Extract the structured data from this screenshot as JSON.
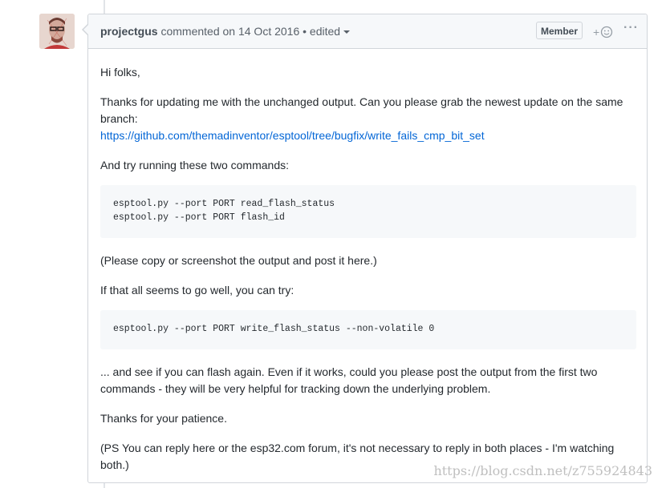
{
  "comment": {
    "author": "projectgus",
    "action_text": " commented on 14 Oct 2016 • edited",
    "badge": "Member",
    "reaction_plus": "+",
    "more_icon": "···",
    "body": {
      "p1": "Hi folks,",
      "p2": "Thanks for updating me with the unchanged output. Can you please grab the newest update on the same branch:",
      "link": "https://github.com/themadinventor/esptool/tree/bugfix/write_fails_cmp_bit_set",
      "p3": "And try running these two commands:",
      "code1": [
        "esptool.py --port PORT read_flash_status",
        "esptool.py --port PORT flash_id"
      ],
      "p4": "(Please copy or screenshot the output and post it here.)",
      "p5": "If that all seems to go well, you can try:",
      "code2": [
        "esptool.py --port PORT write_flash_status --non-volatile 0"
      ],
      "p6": "... and see if you can flash again. Even if it works, could you please post the output from the first two commands - they will be very helpful for tracking down the underlying problem.",
      "p7": "Thanks for your patience.",
      "p8": "(PS You can reply here or the esp32.com forum, it's not necessary to reply in both places - I'm watching both.)"
    }
  },
  "watermark": "https://blog.csdn.net/z755924843",
  "colors": {
    "link": "#0366d6",
    "border": "#d1d5da",
    "header_bg": "#f6f8fa"
  }
}
